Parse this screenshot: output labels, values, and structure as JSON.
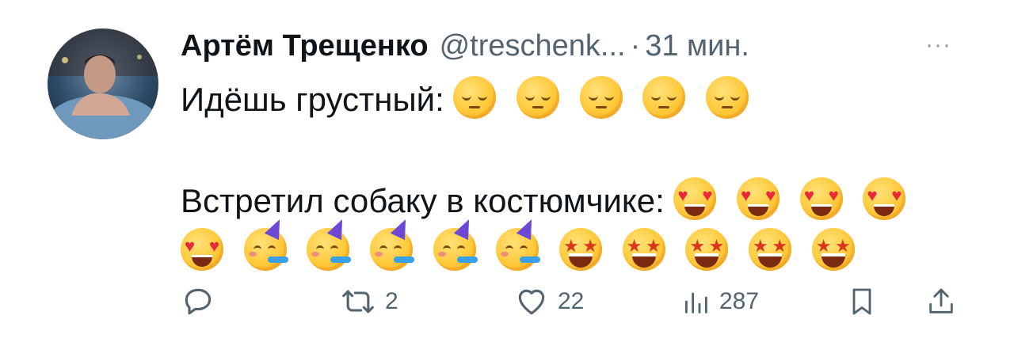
{
  "tweet": {
    "author_name": "Артём Трещенко",
    "handle": "@treschenk...",
    "separator": "·",
    "time": "31 мин.",
    "more_icon": "ellipsis-icon",
    "lines": [
      {
        "text": "Идёшь грустный: ",
        "emojis": [
          "pensive",
          "pensive",
          "pensive",
          "pensive",
          "pensive"
        ]
      },
      {
        "text": "",
        "emojis": []
      },
      {
        "text": "Встретил собаку в костюмчике:",
        "emojis": [
          "heart-eyes",
          "heart-eyes",
          "heart-eyes",
          "heart-eyes"
        ]
      },
      {
        "text": "",
        "emojis": [
          "heart-eyes",
          "partying",
          "partying",
          "partying",
          "partying",
          "partying",
          "star-struck",
          "star-struck",
          "star-struck",
          "star-struck",
          "star-struck"
        ]
      }
    ],
    "actions": {
      "reply_count": "",
      "retweet_count": "2",
      "like_count": "22",
      "views_count": "287"
    }
  }
}
